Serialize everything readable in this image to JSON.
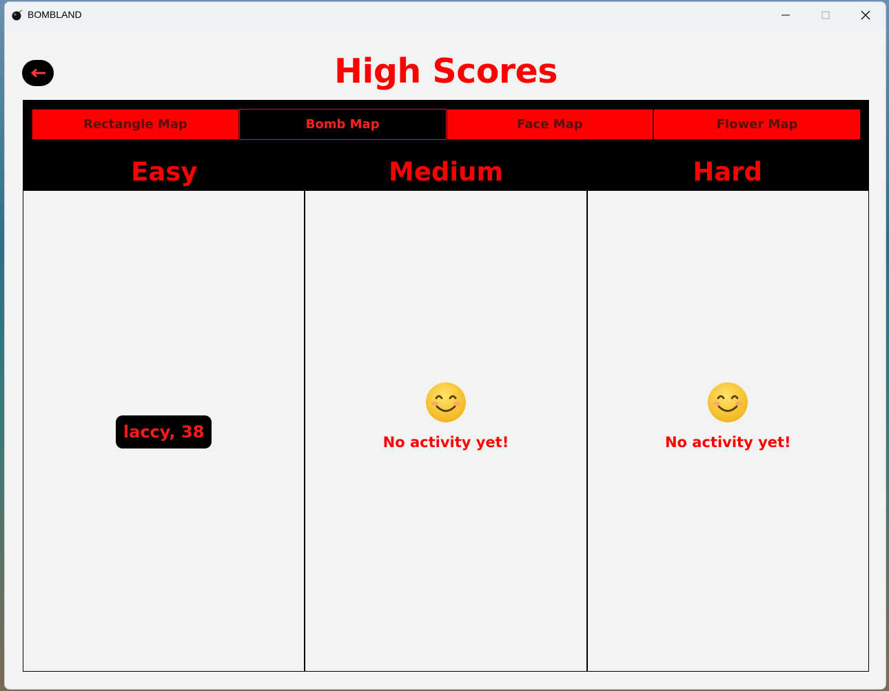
{
  "window": {
    "title": "BOMBLAND",
    "controls": {
      "minimize": "minimize-icon",
      "maximize": "maximize-icon",
      "close": "close-icon"
    }
  },
  "header": {
    "back_icon": "arrow-left-icon",
    "title": "High Scores"
  },
  "tabs": [
    {
      "label": "Rectangle Map",
      "selected": false
    },
    {
      "label": "Bomb Map",
      "selected": true
    },
    {
      "label": "Face Map",
      "selected": false
    },
    {
      "label": "Flower Map",
      "selected": false
    }
  ],
  "difficulties": [
    {
      "label": "Easy",
      "entry": "laccy, 38"
    },
    {
      "label": "Medium",
      "empty_message": "No activity yet!"
    },
    {
      "label": "Hard",
      "empty_message": "No activity yet!"
    }
  ],
  "colors": {
    "accent": "#ff0000",
    "dark": "#000000",
    "background": "#f3f3f3"
  }
}
